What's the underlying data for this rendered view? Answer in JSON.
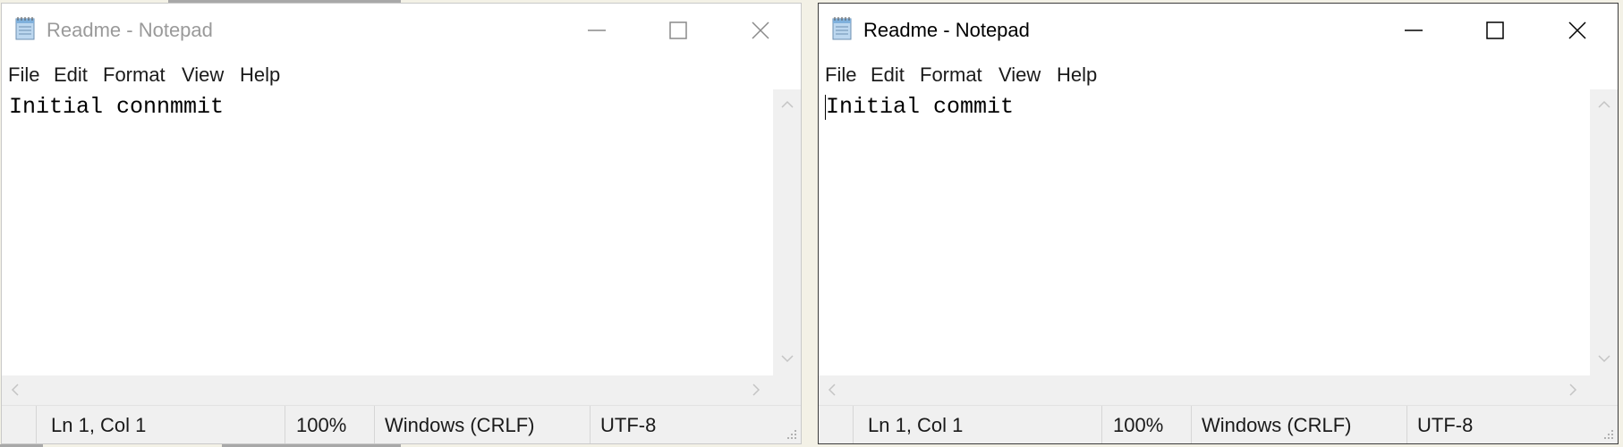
{
  "windows": [
    {
      "state": "inactive",
      "title": "Readme - Notepad",
      "menu": [
        "File",
        "Edit",
        "Format",
        "View",
        "Help"
      ],
      "content": "Initial connmmit",
      "status": {
        "position": "Ln 1, Col 1",
        "zoom": "100%",
        "line_ending": "Windows (CRLF)",
        "encoding": "UTF-8"
      }
    },
    {
      "state": "active",
      "title": "Readme - Notepad",
      "menu": [
        "File",
        "Edit",
        "Format",
        "View",
        "Help"
      ],
      "content": "Initial commit",
      "status": {
        "position": "Ln 1, Col 1",
        "zoom": "100%",
        "line_ending": "Windows (CRLF)",
        "encoding": "UTF-8"
      }
    }
  ],
  "icons": {
    "app": "notepad-icon",
    "minimize": "minimize-icon",
    "maximize": "maximize-icon",
    "close": "close-icon"
  },
  "colors": {
    "inactive_title": "#9a9a9a",
    "active_title": "#000000",
    "chrome": "#f0f0f0",
    "desktop": "#f3f1e6"
  }
}
